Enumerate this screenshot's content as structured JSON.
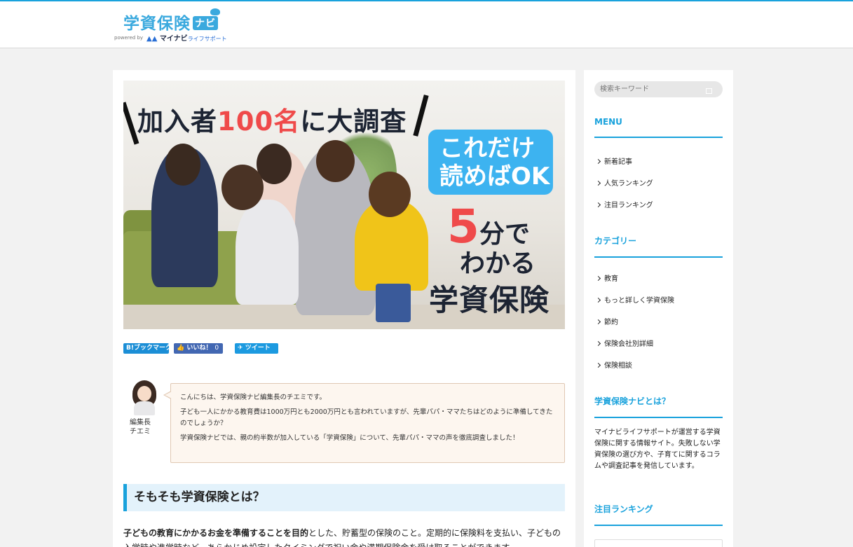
{
  "header": {
    "logo_title": "学資保険",
    "logo_navi": "ナビ",
    "logo_powered": "powered by",
    "logo_brand": "マイナビ",
    "logo_brand_sub": "ライフサポート",
    "accent_color": "#19a2dc"
  },
  "hero": {
    "headline_pre": "加入者",
    "headline_num": "100名",
    "headline_post": "に大調査",
    "badge_line1": "これだけ",
    "badge_line2": "読めばOK",
    "five": "5",
    "minutes": "分で",
    "wakaru": "わかる",
    "topic": "学資保険"
  },
  "share": {
    "hatena": "B!ブックマーク",
    "like": "いいね！",
    "like_count": "0",
    "tweet": "ツイート"
  },
  "author": {
    "name_line1": "編集長",
    "name_line2": "チエミ"
  },
  "bubble": {
    "p1": "こんにちは、学資保険ナビ編集長のチエミです。",
    "p2": "子ども一人にかかる教育費は1000万円とも2000万円とも言われていますが、先輩パパ・ママたちはどのように準備してきたのでしょうか？",
    "p3": "学資保険ナビでは、親の約半数が加入している「学資保険」について、先輩パパ・ママの声を徹底調査しました！"
  },
  "article": {
    "h2": "そもそも学資保険とは？",
    "intro_bold": "子どもの教育にかかるお金を準備することを目的",
    "intro_rest": "とした、貯蓄型の保険のこと。定期的に保険料を支払い、子どもの",
    "intro_cont": "入学時や進学時など、あらかじめ設定したタイミングで祝い金や満期保険金を受け取ることができます。"
  },
  "sidebar": {
    "search_placeholder": "検索キーワード",
    "menu_heading": "MENU",
    "menu_items": [
      "新着記事",
      "人気ランキング",
      "注目ランキング"
    ],
    "category_heading": "カテゴリー",
    "category_items": [
      "教育",
      "もっと詳しく学資保険",
      "節約",
      "保険会社別詳細",
      "保険相談"
    ],
    "about_heading": "学資保険ナビとは？",
    "about_text": "マイナビライフサポートが運営する学資保険に関する情報サイト。失敗しない学資保険の選び方や、子育てに関するコラムや調査記事を発信しています。",
    "ranking_heading": "注目ランキング"
  }
}
